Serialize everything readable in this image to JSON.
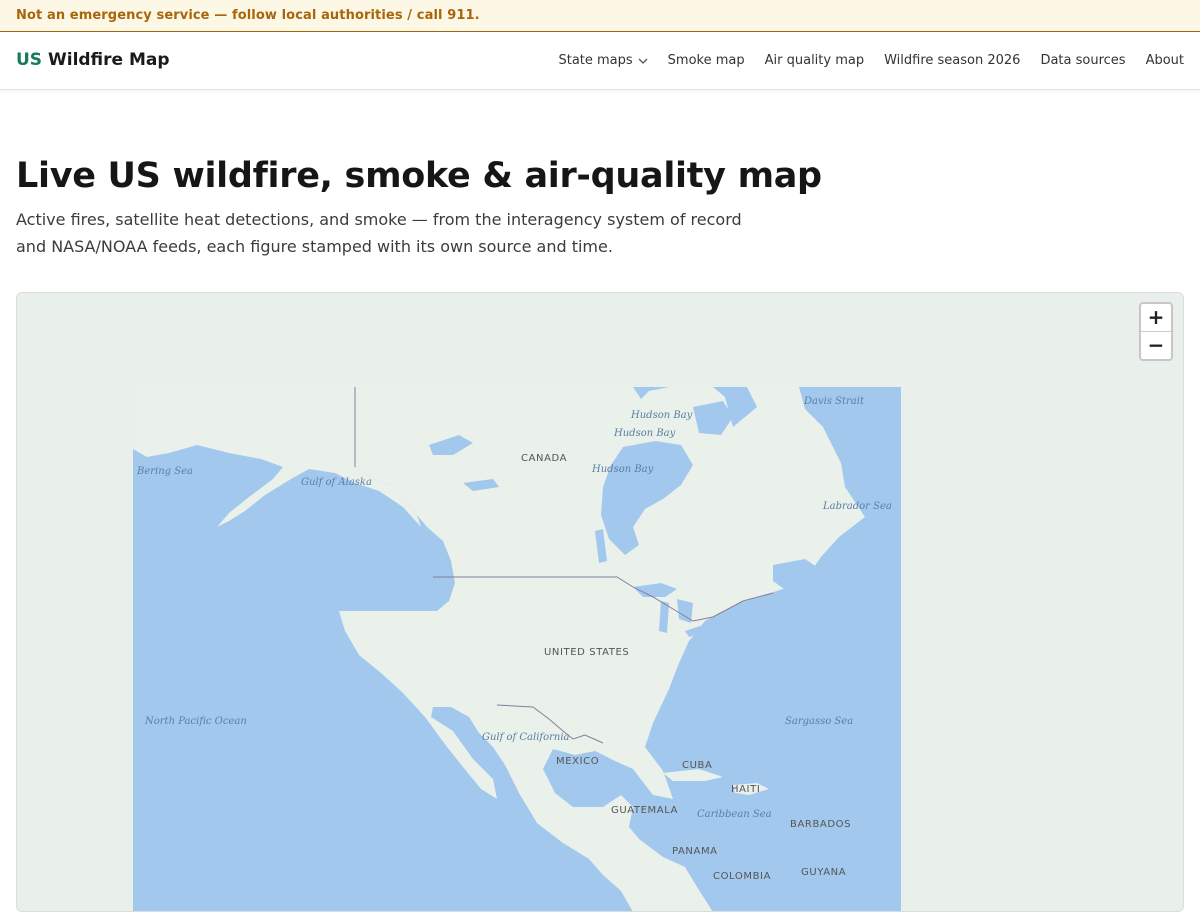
{
  "banner": {
    "text": "Not an emergency service — follow local authorities / call 911."
  },
  "header": {
    "logo_accent": "US",
    "logo_rest": "Wildfire Map",
    "nav": [
      {
        "label": "State maps",
        "icon": "chevron-down-icon"
      },
      {
        "label": "Smoke map"
      },
      {
        "label": "Air quality map"
      },
      {
        "label": "Wildfire season 2026"
      },
      {
        "label": "Data sources"
      },
      {
        "label": "About"
      }
    ]
  },
  "hero": {
    "title": "Live US wildfire, smoke & air-quality map",
    "subtitle": "Active fires, satellite heat detections, and smoke — from the interagency system of record and NASA/NOAA feeds, each figure stamped with its own source and time."
  },
  "map": {
    "zoom_in": "+",
    "zoom_out": "−",
    "land_color": "#eaf0ea",
    "water_color": "#a3c8ee",
    "labels": {
      "canada": "CANADA",
      "united_states": "UNITED STATES",
      "mexico": "MEXICO",
      "cuba": "CUBA",
      "haiti": "HAITI",
      "guatemala": "GUATEMALA",
      "panama": "PANAMA",
      "colombia": "COLOMBIA",
      "guyana": "GUYANA",
      "barbados": "BARBADOS",
      "bering_sea": "Bering Sea",
      "gulf_of_alaska": "Gulf of Alaska",
      "hudson_bay_1": "Hudson Bay",
      "hudson_bay_2": "Hudson Bay",
      "hudson_bay_3": "Hudson Bay",
      "davis_strait": "Davis Strait",
      "labrador_sea": "Labrador Sea",
      "north_pacific_ocean": "North Pacific Ocean",
      "gulf_of_california": "Gulf of California",
      "sargasso_sea": "Sargasso Sea",
      "caribbean_sea": "Caribbean Sea"
    }
  }
}
